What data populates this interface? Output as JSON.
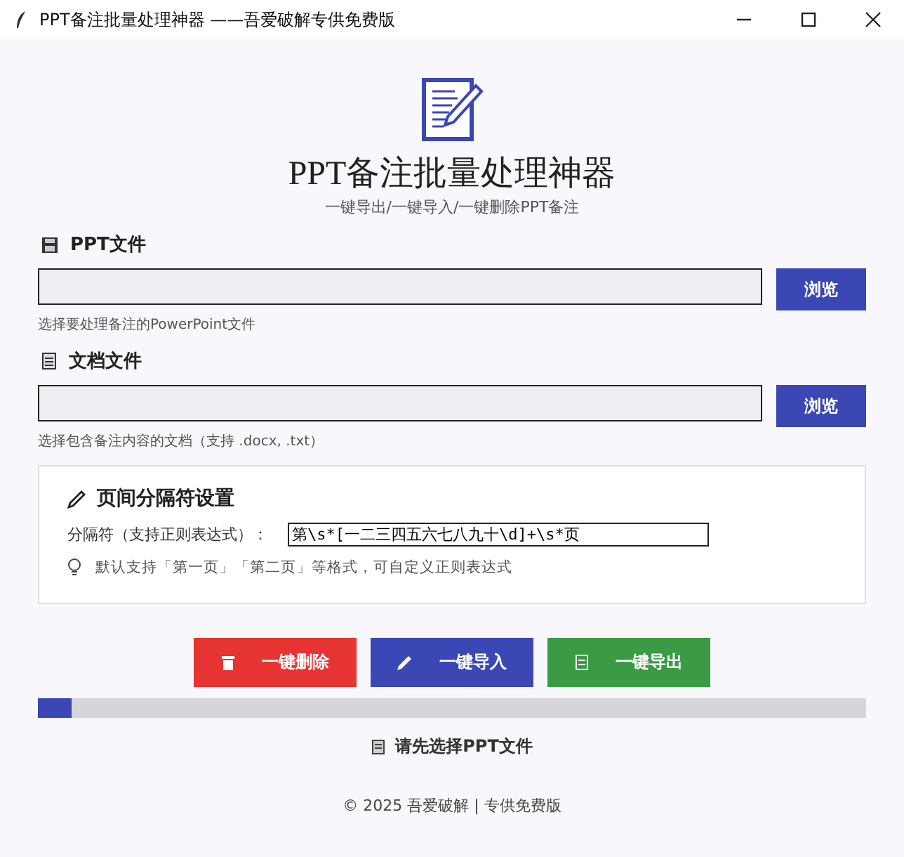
{
  "window": {
    "title": "PPT备注批量处理神器 ——吾爱破解专供免费版"
  },
  "header": {
    "title": "PPT备注批量处理神器",
    "subtitle": "一键导出/一键导入/一键删除PPT备注"
  },
  "file_sections": [
    {
      "kind": "ppt",
      "label": "PPT文件",
      "button": "浏览",
      "hint": "选择要处理备注的PowerPoint文件"
    },
    {
      "kind": "doc",
      "label": "文档文件",
      "button": "浏览",
      "hint": "选择包含备注内容的文档（支持 .docx, .txt）"
    }
  ],
  "separator": {
    "title": "页间分隔符设置",
    "field_label": "分隔符（支持正则表达式）：",
    "value": "第\\s*[一二三四五六七八九十\\d]+\\s*页",
    "hint": "默认支持「第一页」「第二页」等格式，可自定义正则表达式"
  },
  "actions": [
    {
      "kind": "delete",
      "label": "一键删除"
    },
    {
      "kind": "import",
      "label": "一键导入"
    },
    {
      "kind": "export",
      "label": "一键导出"
    }
  ],
  "progress": {
    "level": 0.04
  },
  "status": "请先选择PPT文件",
  "footer": "© 2025 吾爱破解 | 专供免费版"
}
